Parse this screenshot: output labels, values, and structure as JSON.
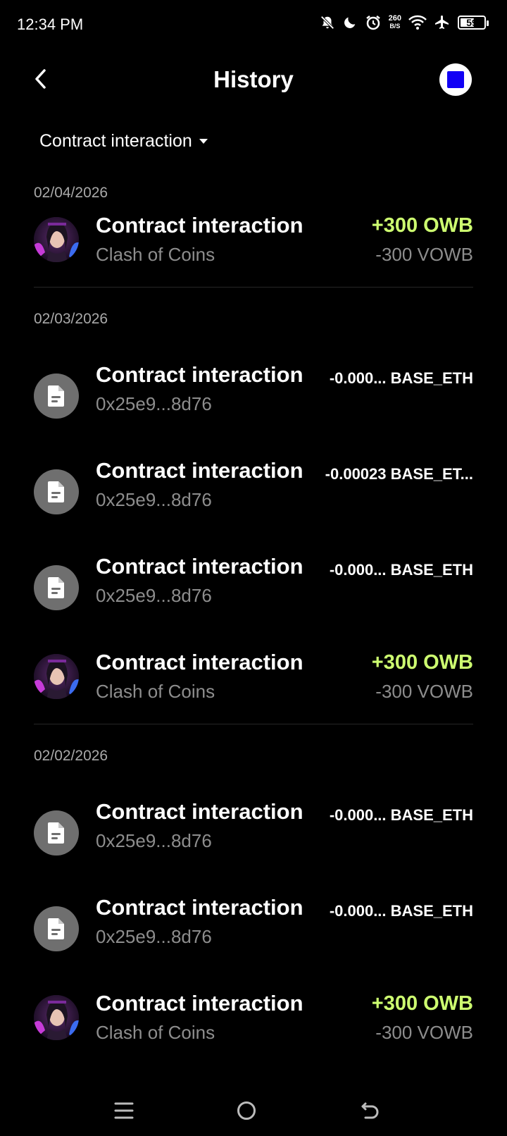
{
  "status_bar": {
    "time": "12:34 PM",
    "net_speed_value": "260",
    "net_speed_unit": "B/S",
    "battery_level": "59",
    "icons": [
      "bell-off-icon",
      "moon-icon",
      "alarm-icon",
      "wifi-icon",
      "airplane-icon",
      "battery-icon"
    ]
  },
  "header": {
    "title": "History",
    "back_icon": "chevron-left-icon",
    "account_color": "#1100f5"
  },
  "filter": {
    "label": "Contract interaction"
  },
  "groups": [
    {
      "date": "02/04/2026",
      "items": [
        {
          "icon": "game-avatar",
          "title": "Contract interaction",
          "subtitle": "Clash of Coins",
          "amount_primary": "+300 OWB",
          "amount_secondary": "-300 VOWB"
        }
      ]
    },
    {
      "date": "02/03/2026",
      "items": [
        {
          "icon": "document-icon",
          "title": "Contract interaction",
          "subtitle": "0x25e9...8d76",
          "amount_primary": "-0.000... BASE_ETH"
        },
        {
          "icon": "document-icon",
          "title": "Contract interaction",
          "subtitle": "0x25e9...8d76",
          "amount_primary": "-0.00023 BASE_ET..."
        },
        {
          "icon": "document-icon",
          "title": "Contract interaction",
          "subtitle": "0x25e9...8d76",
          "amount_primary": "-0.000... BASE_ETH"
        },
        {
          "icon": "game-avatar",
          "title": "Contract interaction",
          "subtitle": "Clash of Coins",
          "amount_primary": "+300 OWB",
          "amount_secondary": "-300 VOWB"
        }
      ]
    },
    {
      "date": "02/02/2026",
      "items": [
        {
          "icon": "document-icon",
          "title": "Contract interaction",
          "subtitle": "0x25e9...8d76",
          "amount_primary": "-0.000... BASE_ETH"
        },
        {
          "icon": "document-icon",
          "title": "Contract interaction",
          "subtitle": "0x25e9...8d76",
          "amount_primary": "-0.000... BASE_ETH"
        },
        {
          "icon": "game-avatar",
          "title": "Contract interaction",
          "subtitle": "Clash of Coins",
          "amount_primary": "+300 OWB",
          "amount_secondary": "-300 VOWB"
        }
      ]
    }
  ],
  "colors": {
    "positive": "#cdfe70",
    "muted": "#8d8d8d",
    "background": "#000000"
  },
  "nav_bar": {
    "icons": [
      "menu-icon",
      "home-icon",
      "back-icon"
    ]
  }
}
